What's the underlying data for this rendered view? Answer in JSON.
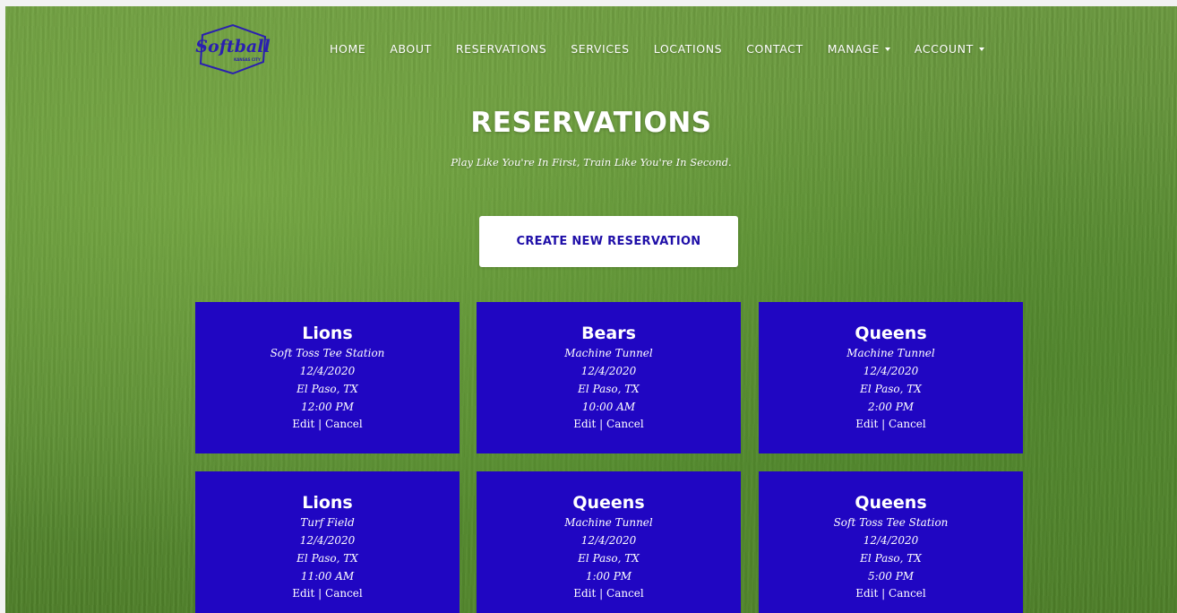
{
  "brand": {
    "logo_text": "Softball",
    "logo_subtext": "KANSAS CITY"
  },
  "nav": {
    "home": "HOME",
    "about": "ABOUT",
    "reservations": "RESERVATIONS",
    "services": "SERVICES",
    "locations": "LOCATIONS",
    "contact": "CONTACT",
    "manage": "MANAGE",
    "account": "ACCOUNT"
  },
  "hero": {
    "title": "RESERVATIONS",
    "subtitle": "Play Like You're In First, Train Like You're In Second."
  },
  "create_button": "CREATE NEW RESERVATION",
  "colors": {
    "card_bg": "#2006c2",
    "button_text": "#1f0fa8"
  },
  "reservations": [
    {
      "team": "Lions",
      "service": "Soft Toss Tee Station",
      "date": "12/4/2020",
      "location": "El Paso, TX",
      "time": "12:00 PM",
      "edit": "Edit",
      "sep": " | ",
      "cancel": "Cancel"
    },
    {
      "team": "Bears",
      "service": "Machine Tunnel",
      "date": "12/4/2020",
      "location": "El Paso, TX",
      "time": "10:00 AM",
      "edit": "Edit",
      "sep": " | ",
      "cancel": "Cancel"
    },
    {
      "team": "Queens",
      "service": "Machine Tunnel",
      "date": "12/4/2020",
      "location": "El Paso, TX",
      "time": "2:00 PM",
      "edit": "Edit",
      "sep": " | ",
      "cancel": "Cancel"
    },
    {
      "team": "Lions",
      "service": "Turf Field",
      "date": "12/4/2020",
      "location": "El Paso, TX",
      "time": "11:00 AM",
      "edit": "Edit",
      "sep": " | ",
      "cancel": "Cancel"
    },
    {
      "team": "Queens",
      "service": "Machine Tunnel",
      "date": "12/4/2020",
      "location": "El Paso, TX",
      "time": "1:00 PM",
      "edit": "Edit",
      "sep": " | ",
      "cancel": "Cancel"
    },
    {
      "team": "Queens",
      "service": "Soft Toss Tee Station",
      "date": "12/4/2020",
      "location": "El Paso, TX",
      "time": "5:00 PM",
      "edit": "Edit",
      "sep": " | ",
      "cancel": "Cancel"
    }
  ]
}
